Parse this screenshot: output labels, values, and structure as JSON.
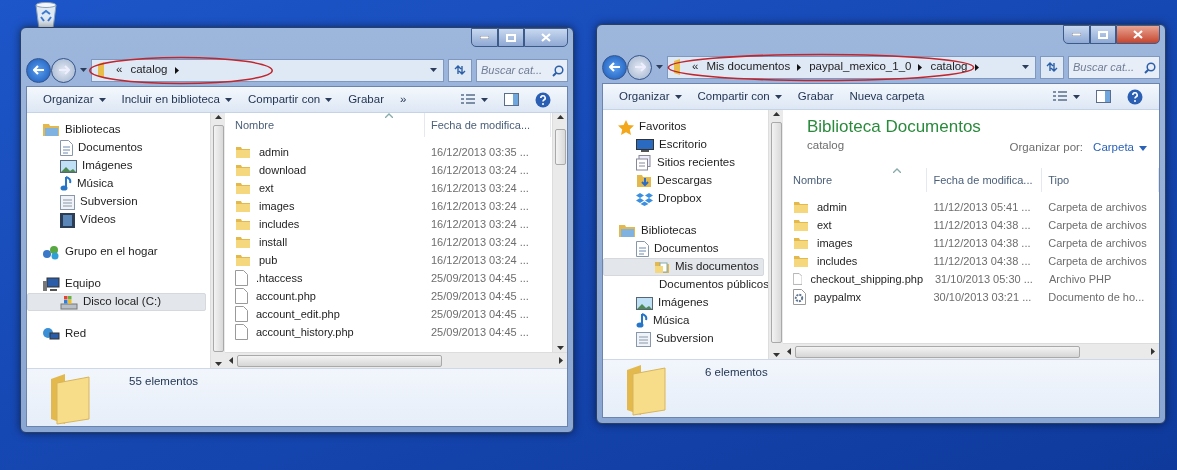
{
  "windows": [
    {
      "active": false,
      "address": {
        "prefix": "«",
        "segments": [
          "catalog"
        ],
        "highlighted": true
      },
      "search": {
        "placeholder": "Buscar cat..."
      },
      "toolbar": [
        {
          "label": "Organizar",
          "has_menu": true
        },
        {
          "label": "Incluir en biblioteca",
          "has_menu": true
        },
        {
          "label": "Compartir con",
          "has_menu": true
        },
        {
          "label": "Grabar",
          "has_menu": false
        },
        {
          "label": "»",
          "has_menu": false
        }
      ],
      "nav": [
        {
          "label": "Bibliotecas",
          "kind": "library",
          "selected": false,
          "children": [
            {
              "label": "Documentos",
              "kind": "document",
              "selected": false
            },
            {
              "label": "Imágenes",
              "kind": "picture",
              "selected": false
            },
            {
              "label": "Música",
              "kind": "music",
              "selected": false
            },
            {
              "label": "Subversion",
              "kind": "textfile",
              "selected": false
            },
            {
              "label": "Vídeos",
              "kind": "video",
              "selected": false
            }
          ]
        },
        {
          "label": "Grupo en el hogar",
          "kind": "homegroup",
          "selected": false
        },
        {
          "label": "Equipo",
          "kind": "computer",
          "selected": false,
          "children": [
            {
              "label": "Disco local (C:)",
              "kind": "drive",
              "selected": true
            }
          ]
        },
        {
          "label": "Red",
          "kind": "network",
          "selected": false
        }
      ],
      "columns": [
        "Nombre",
        "Fecha de modifica..."
      ],
      "rows": [
        {
          "kind": "folder",
          "name": "admin",
          "date": "16/12/2013 03:35 ..."
        },
        {
          "kind": "folder",
          "name": "download",
          "date": "16/12/2013 03:24 ..."
        },
        {
          "kind": "folder",
          "name": "ext",
          "date": "16/12/2013 03:24 ..."
        },
        {
          "kind": "folder",
          "name": "images",
          "date": "16/12/2013 03:24 ..."
        },
        {
          "kind": "folder",
          "name": "includes",
          "date": "16/12/2013 03:24 ..."
        },
        {
          "kind": "folder",
          "name": "install",
          "date": "16/12/2013 03:24 ..."
        },
        {
          "kind": "folder",
          "name": "pub",
          "date": "16/12/2013 03:24 ..."
        },
        {
          "kind": "file",
          "name": ".htaccess",
          "date": "25/09/2013 04:45 ..."
        },
        {
          "kind": "file",
          "name": "account.php",
          "date": "25/09/2013 04:45 ..."
        },
        {
          "kind": "file",
          "name": "account_edit.php",
          "date": "25/09/2013 04:45 ..."
        },
        {
          "kind": "file",
          "name": "account_history.php",
          "date": "25/09/2013 04:45 ..."
        }
      ],
      "status": "55 elementos"
    },
    {
      "active": true,
      "address": {
        "prefix": "«",
        "segments": [
          "Mis documentos",
          "paypal_mexico_1_0",
          "catalog"
        ],
        "highlighted": true
      },
      "search": {
        "placeholder": "Buscar cat..."
      },
      "toolbar": [
        {
          "label": "Organizar",
          "has_menu": true
        },
        {
          "label": "Compartir con",
          "has_menu": true
        },
        {
          "label": "Grabar",
          "has_menu": false
        },
        {
          "label": "Nueva carpeta",
          "has_menu": false
        }
      ],
      "nav": [
        {
          "label": "Favoritos",
          "kind": "star",
          "selected": false,
          "children": [
            {
              "label": "Escritorio",
              "kind": "desktop",
              "selected": false
            },
            {
              "label": "Sitios recientes",
              "kind": "recent",
              "selected": false
            },
            {
              "label": "Descargas",
              "kind": "downloads",
              "selected": false
            },
            {
              "label": "Dropbox",
              "kind": "dropbox",
              "selected": false
            }
          ]
        },
        {
          "label": "Bibliotecas",
          "kind": "library",
          "selected": false,
          "children": [
            {
              "label": "Documentos",
              "kind": "document",
              "selected": false,
              "children": [
                {
                  "label": "Mis documentos",
                  "kind": "folderdoc",
                  "selected": true
                },
                {
                  "label": "Documentos públicos",
                  "kind": "folder",
                  "selected": false
                }
              ]
            },
            {
              "label": "Imágenes",
              "kind": "picture",
              "selected": false
            },
            {
              "label": "Música",
              "kind": "music",
              "selected": false
            },
            {
              "label": "Subversion",
              "kind": "textfile",
              "selected": false
            }
          ]
        }
      ],
      "library": {
        "title": "Biblioteca Documentos",
        "subtitle": "catalog",
        "arrange_label": "Organizar por:",
        "arrange_value": "Carpeta"
      },
      "columns": [
        "Nombre",
        "Fecha de modifica...",
        "Tipo"
      ],
      "rows": [
        {
          "kind": "folder",
          "name": "admin",
          "date": "11/12/2013 05:41 ...",
          "type": "Carpeta de archivos"
        },
        {
          "kind": "folder",
          "name": "ext",
          "date": "11/12/2013 04:38 ...",
          "type": "Carpeta de archivos"
        },
        {
          "kind": "folder",
          "name": "images",
          "date": "11/12/2013 04:38 ...",
          "type": "Carpeta de archivos"
        },
        {
          "kind": "folder",
          "name": "includes",
          "date": "11/12/2013 04:38 ...",
          "type": "Carpeta de archivos"
        },
        {
          "kind": "file",
          "name": "checkout_shipping.php",
          "date": "31/10/2013 05:30 ...",
          "type": "Archivo PHP"
        },
        {
          "kind": "settings",
          "name": "paypalmx",
          "date": "30/10/2013 03:21 ...",
          "type": "Documento de ho..."
        }
      ],
      "status": "6 elementos"
    }
  ]
}
